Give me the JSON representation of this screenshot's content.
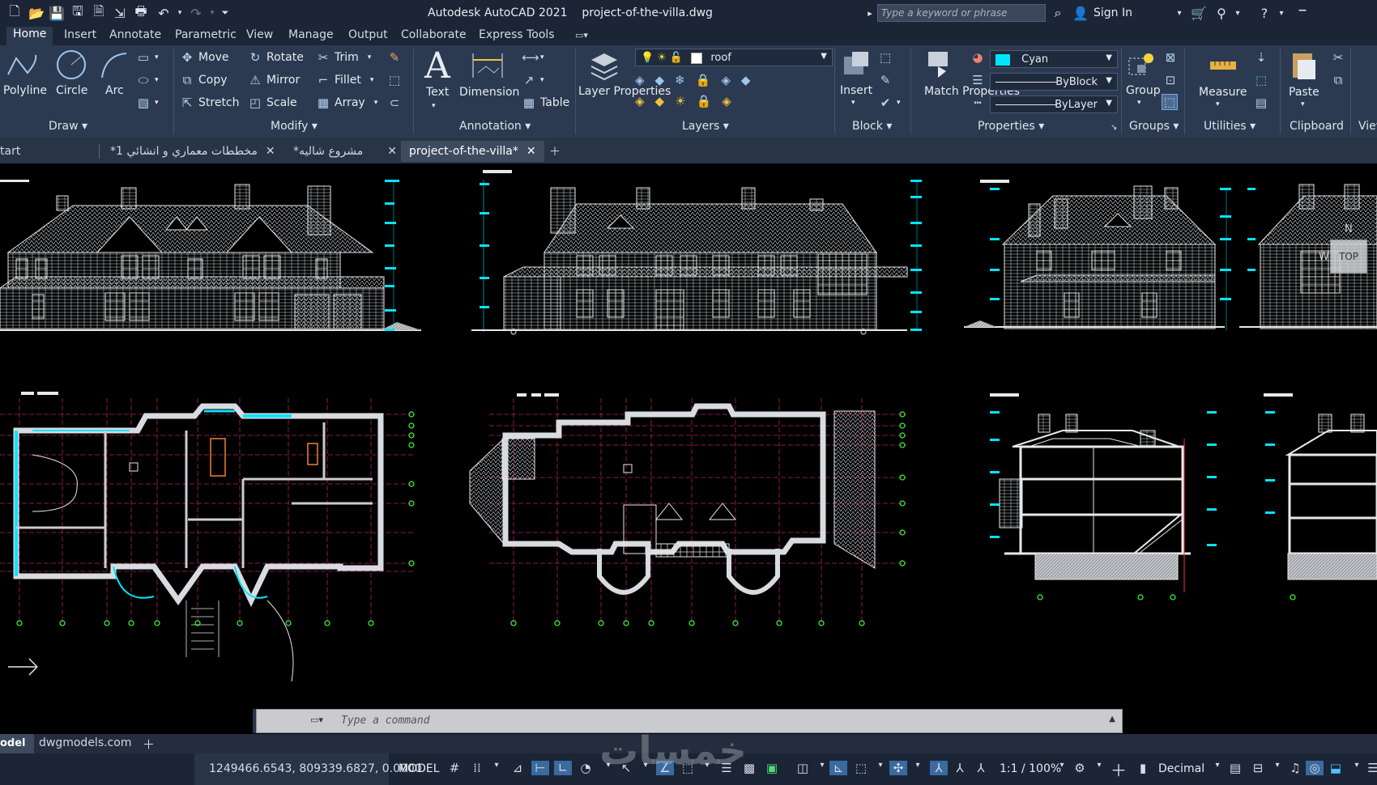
{
  "app": {
    "title": "Autodesk AutoCAD 2021",
    "file": "project-of-the-villa.dwg",
    "search_placeholder": "Type a keyword or phrase",
    "sign_in": "Sign In"
  },
  "ribbon_tabs": [
    "Home",
    "Insert",
    "Annotate",
    "Parametric",
    "View",
    "Manage",
    "Output",
    "Collaborate",
    "Express Tools"
  ],
  "draw": {
    "polyline": "Polyline",
    "circle": "Circle",
    "arc": "Arc",
    "footer": "Draw"
  },
  "modify": {
    "move": "Move",
    "rotate": "Rotate",
    "trim": "Trim",
    "copy": "Copy",
    "mirror": "Mirror",
    "fillet": "Fillet",
    "stretch": "Stretch",
    "scale": "Scale",
    "array": "Array",
    "footer": "Modify"
  },
  "annotation": {
    "text": "Text",
    "dimension": "Dimension",
    "table": "Table",
    "footer": "Annotation"
  },
  "layers": {
    "layer_properties": "Layer Properties",
    "current_layer": "roof",
    "footer": "Layers"
  },
  "block": {
    "insert": "Insert",
    "footer": "Block"
  },
  "properties": {
    "match": "Match Properties",
    "color": "Cyan",
    "color_hex": "#00e5ff",
    "lineweight": "ByBlock",
    "linetype": "ByLayer",
    "footer": "Properties"
  },
  "groups": {
    "group": "Group",
    "footer": "Groups"
  },
  "utilities": {
    "measure": "Measure",
    "footer": "Utilities"
  },
  "clipboard": {
    "paste": "Paste",
    "footer": "Clipboard"
  },
  "view_footer": "View",
  "doc_tabs": [
    {
      "label": "tart",
      "closable": false
    },
    {
      "label": "مخططات معماري و انشائي 1*",
      "closable": true
    },
    {
      "label": "مشروع شاليه*",
      "closable": true
    },
    {
      "label": "project-of-the-villa*",
      "closable": true,
      "active": true
    }
  ],
  "viewcube": {
    "top": "TOP",
    "n": "N",
    "w": "W"
  },
  "command_placeholder": "Type a command",
  "layout_tabs": [
    "odel",
    "dwgmodels.com"
  ],
  "status": {
    "coords": "1249466.6543, 809339.6827, 0.0000",
    "model": "MODEL",
    "scale": "1:1 / 100%",
    "units": "Decimal"
  },
  "watermark": "خمسات",
  "colors": {
    "accent": "#00e5ff",
    "titlebar": "#1b2536",
    "ribbon": "#2c3a51",
    "grid_line": "#b0245a",
    "axis_bubble": "#3cff3c",
    "dim_text": "#00e5ff"
  }
}
